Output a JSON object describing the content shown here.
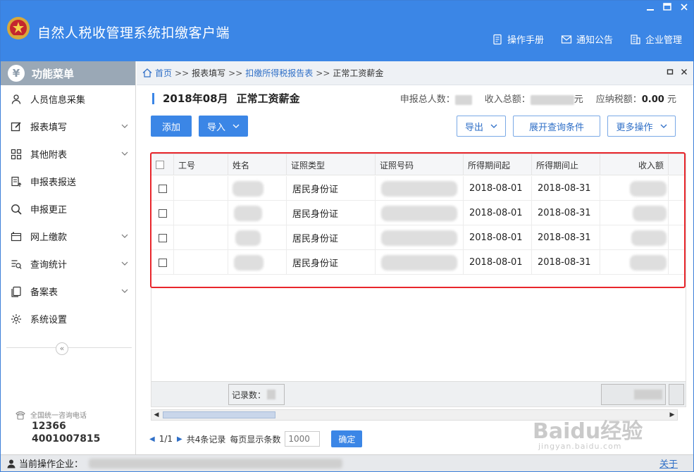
{
  "titlebar": {
    "title": "自然人税收管理系统扣缴客户端",
    "links": [
      {
        "label": "操作手册",
        "icon": "manual-icon"
      },
      {
        "label": "通知公告",
        "icon": "mail-icon"
      },
      {
        "label": "企业管理",
        "icon": "building-icon"
      }
    ]
  },
  "sidebar": {
    "header": "功能菜单",
    "items": [
      {
        "label": "人员信息采集",
        "icon": "person-icon",
        "expandable": false
      },
      {
        "label": "报表填写",
        "icon": "edit-icon",
        "expandable": true
      },
      {
        "label": "其他附表",
        "icon": "grid-icon",
        "expandable": true
      },
      {
        "label": "申报表报送",
        "icon": "upload-doc-icon",
        "expandable": false
      },
      {
        "label": "申报更正",
        "icon": "search-icon",
        "expandable": false
      },
      {
        "label": "网上缴款",
        "icon": "wallet-icon",
        "expandable": true
      },
      {
        "label": "查询统计",
        "icon": "query-list-icon",
        "expandable": true
      },
      {
        "label": "备案表",
        "icon": "copy-doc-icon",
        "expandable": true
      },
      {
        "label": "系统设置",
        "icon": "gear-icon",
        "expandable": false
      }
    ],
    "collapse": "«",
    "hotline": {
      "label": "全国统一咨询电话",
      "numbers": [
        "12366",
        "4001007815"
      ]
    }
  },
  "breadcrumb": {
    "home": "首页",
    "step1": "报表填写",
    "step2": "扣缴所得税报告表",
    "current": "正常工资薪金",
    "sep": ">>"
  },
  "page": {
    "period": "2018年08月",
    "title": "正常工资薪金",
    "summary": {
      "count_label": "申报总人数：",
      "income_label": "收入总额：",
      "income_unit": "元",
      "tax_label": "应纳税额：",
      "tax_value": "0.00",
      "tax_unit": "元"
    }
  },
  "toolbar": {
    "add": "添加",
    "import": "导入",
    "export": "导出",
    "expand_query": "展开查询条件",
    "more": "更多操作"
  },
  "grid": {
    "columns": [
      "工号",
      "姓名",
      "证照类型",
      "证照号码",
      "所得期间起",
      "所得期间止",
      "收入额"
    ],
    "rows": [
      {
        "id_type": "居民身份证",
        "start": "2018-08-01",
        "end": "2018-08-31"
      },
      {
        "id_type": "居民身份证",
        "start": "2018-08-01",
        "end": "2018-08-31"
      },
      {
        "id_type": "居民身份证",
        "start": "2018-08-01",
        "end": "2018-08-31"
      },
      {
        "id_type": "居民身份证",
        "start": "2018-08-01",
        "end": "2018-08-31"
      }
    ],
    "footer_records_label": "记录数："
  },
  "pager": {
    "page": "1/1",
    "total": "共4条记录",
    "per_page_label": "每页显示条数",
    "per_page_placeholder": "1000",
    "confirm": "确定"
  },
  "statusbar": {
    "label": "当前操作企业：",
    "about": "关于"
  },
  "watermark": {
    "main": "Baidu经验",
    "sub": "jingyan.baidu.com"
  },
  "colors": {
    "brand": "#3b86e6",
    "highlight": "#e8262c"
  }
}
